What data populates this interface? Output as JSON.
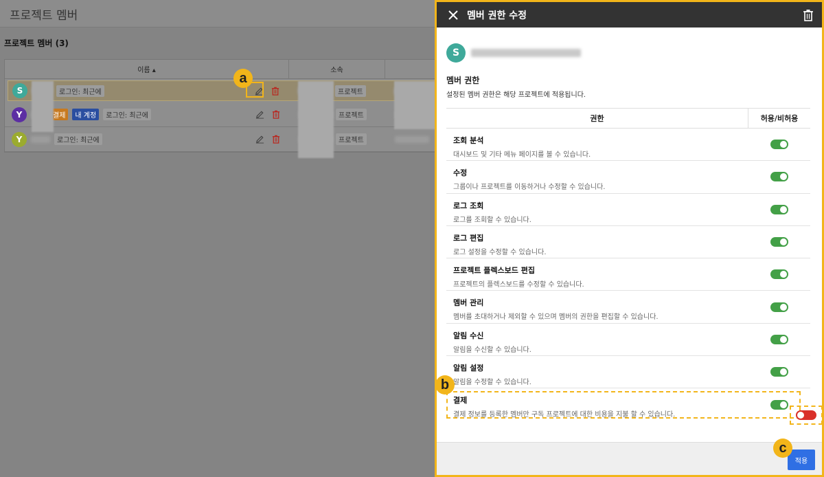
{
  "page": {
    "title": "프로젝트 멤버",
    "section_title": "프로젝트 멤버 (3)"
  },
  "member_table": {
    "headers": {
      "name": "이름 ▴",
      "org": "소속"
    },
    "rows": [
      {
        "avatar": "S",
        "avatar_color": "#3fa99a",
        "tags": [],
        "login": "로그인: 최근에",
        "org_tag": "프로젝트"
      },
      {
        "avatar": "Y",
        "avatar_color": "#5c2ea3",
        "tags": [
          "결제",
          "내 계정"
        ],
        "login": "로그인: 최근에",
        "org_tag": "프로젝트"
      },
      {
        "avatar": "Y",
        "avatar_color": "#9bab2f",
        "tags": [],
        "login": "로그인: 최근에",
        "org_tag": "프로젝트"
      }
    ]
  },
  "callouts": {
    "a": "a",
    "b": "b",
    "c": "c"
  },
  "panel": {
    "title": "멤버 권한 수정",
    "user_avatar": "S",
    "permissions_title": "멤버 권한",
    "permissions_desc": "설정된 멤버 권한은 해당 프로젝트에 적용됩니다.",
    "table_headers": {
      "permission": "권한",
      "allow": "허용/비허용"
    },
    "permissions": [
      {
        "name": "조회 분석",
        "desc": "대시보드 및 기타 메뉴 페이지를 볼 수 있습니다.",
        "enabled": true
      },
      {
        "name": "수정",
        "desc": "그룹이나 프로젝트를 이동하거나 수정할 수 있습니다.",
        "enabled": true
      },
      {
        "name": "로그 조회",
        "desc": "로그를 조회할 수 있습니다.",
        "enabled": true
      },
      {
        "name": "로그 편집",
        "desc": "로그 설정을 수정할 수 있습니다.",
        "enabled": true
      },
      {
        "name": "프로젝트 플렉스보드 편집",
        "desc": "프로젝트의 플렉스보드를 수정할 수 있습니다.",
        "enabled": true
      },
      {
        "name": "멤버 관리",
        "desc": "멤버를 초대하거나 제외할 수 있으며 멤버의 권한을 편집할 수 있습니다.",
        "enabled": true
      },
      {
        "name": "알림 수신",
        "desc": "알림을 수신할 수 있습니다.",
        "enabled": true
      },
      {
        "name": "알림 설정",
        "desc": "알림을 수정할 수 있습니다.",
        "enabled": true
      },
      {
        "name": "결제",
        "desc": "결제 정보를 등록한 멤버만 구독 프로젝트에 대한 비용을 지불 할 수 있습니다.",
        "enabled": true
      }
    ],
    "apply_label": "적용"
  },
  "colors": {
    "accent": "#f2b51a",
    "toggle_on": "#43a047",
    "toggle_off": "#d9302a",
    "apply": "#2f6fe4"
  }
}
